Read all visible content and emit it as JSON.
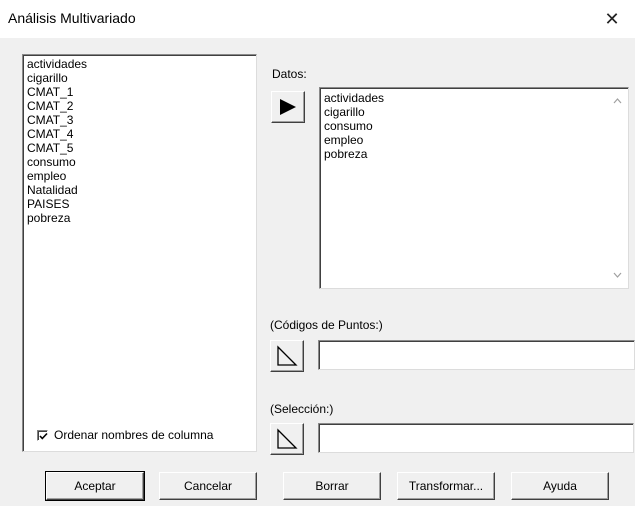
{
  "window": {
    "title": "Análisis Multivariado",
    "close_glyph": "✕"
  },
  "columns_list": {
    "items": [
      "actividades",
      "cigarillo",
      "CMAT_1",
      "CMAT_2",
      "CMAT_3",
      "CMAT_4",
      "CMAT_5",
      "consumo",
      "empleo",
      "Natalidad",
      "PAISES",
      "pobreza"
    ]
  },
  "datos": {
    "label": "Datos:",
    "items": [
      "actividades",
      "cigarillo",
      "consumo",
      "empleo",
      "pobreza"
    ],
    "add_button_icon": "filled-right-arrow-icon"
  },
  "codigos": {
    "label": "(Códigos de Puntos:)",
    "value": "",
    "add_button_icon": "outline-right-arrow-icon"
  },
  "seleccion": {
    "label": "(Selección:)",
    "value": "",
    "add_button_icon": "outline-right-arrow-icon"
  },
  "sort_columns": {
    "label": "Ordenar nombres de columna",
    "checked": true
  },
  "buttons": {
    "aceptar": "Aceptar",
    "cancelar": "Cancelar",
    "borrar": "Borrar",
    "transformar": "Transformar...",
    "ayuda": "Ayuda"
  }
}
